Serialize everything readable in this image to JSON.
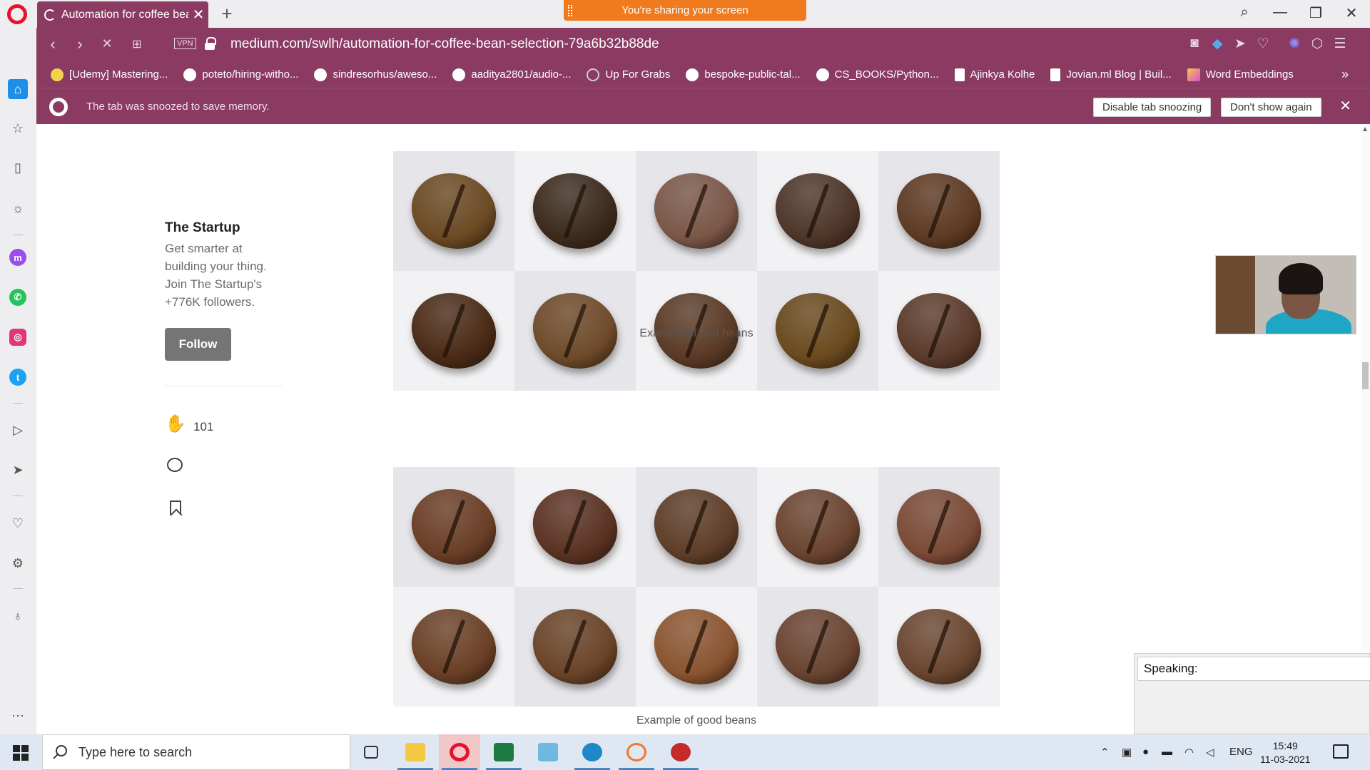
{
  "browser": {
    "tab_title": "Automation for coffee bean",
    "tab_close": "✕",
    "new_tab": "+",
    "sharing_banner": "You're sharing your screen",
    "url": "medium.com/swlh/automation-for-coffee-bean-selection-79a6b32b88de",
    "vpn_label": "VPN",
    "window_controls": {
      "search": "⌕",
      "minimize": "—",
      "restore": "❐",
      "close": "✕"
    },
    "accent_color": "#8b3a62"
  },
  "bookmarks": [
    {
      "label": "[Udemy] Mastering...",
      "icon": "udemy-icon",
      "type": "flower"
    },
    {
      "label": "poteto/hiring-witho...",
      "icon": "github-icon",
      "type": "gh"
    },
    {
      "label": "sindresorhus/aweso...",
      "icon": "github-icon",
      "type": "gh"
    },
    {
      "label": "aaditya2801/audio-...",
      "icon": "github-icon",
      "type": "gh"
    },
    {
      "label": "Up For Grabs",
      "icon": "globe-icon",
      "type": "ring"
    },
    {
      "label": "bespoke-public-tal...",
      "icon": "github-icon",
      "type": "gh"
    },
    {
      "label": "CS_BOOKS/Python...",
      "icon": "github-icon",
      "type": "gh"
    },
    {
      "label": "Ajinkya Kolhe",
      "icon": "document-icon",
      "type": "doc"
    },
    {
      "label": "Jovian.ml Blog | Buil...",
      "icon": "document-icon",
      "type": "doc"
    },
    {
      "label": "Word Embeddings",
      "icon": "word-icon",
      "type": "word"
    }
  ],
  "bookmarks_more": "»",
  "snooze_bar": {
    "message": "The tab was snoozed to save memory.",
    "disable_button": "Disable tab snoozing",
    "dont_show_button": "Don't show again",
    "close": "✕"
  },
  "article": {
    "publication_name": "The Startup",
    "publication_desc": "Get smarter at building your thing. Join The Startup's +776K followers.",
    "follow_button": "Follow",
    "clap_count": "101",
    "bad_beans_caption": "Example of bad beans",
    "good_beans_caption": "Example of good beans"
  },
  "speaking": {
    "label": "Speaking:"
  },
  "taskbar": {
    "search_placeholder": "Type here to search",
    "language": "ENG",
    "time": "15:49",
    "date": "11-03-2021"
  }
}
